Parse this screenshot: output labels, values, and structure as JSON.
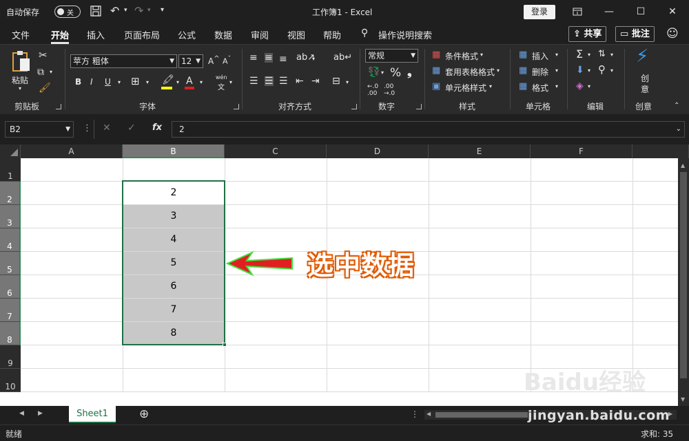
{
  "titlebar": {
    "autosave_label": "自动保存",
    "autosave_state": "关",
    "doc_title": "工作簿1  -  Excel",
    "login_label": "登录"
  },
  "tabs": [
    "文件",
    "开始",
    "插入",
    "页面布局",
    "公式",
    "数据",
    "审阅",
    "视图",
    "帮助"
  ],
  "active_tab": "开始",
  "search_label": "操作说明搜索",
  "share_label": "共享",
  "comment_label": "批注",
  "ribbon": {
    "paste_label": "粘贴",
    "clipboard_label": "剪贴板",
    "font_name": "苹方 粗体",
    "font_size": "12",
    "font_label": "字体",
    "align_label": "对齐方式",
    "number_format": "常规",
    "number_label": "数字",
    "cond_format": "条件格式",
    "table_format": "套用表格格式",
    "cell_style": "单元格样式",
    "style_label": "样式",
    "insert_label": "插入",
    "delete_label": "删除",
    "format_label": "格式",
    "cells_label": "单元格",
    "edit_label": "编辑",
    "create_label1": "创",
    "create_label2": "意",
    "create_group": "创意",
    "bold": "B",
    "italic": "I",
    "underline": "U",
    "phonetic": "wén",
    "phonetic2": "文"
  },
  "formula": {
    "namebox": "B2",
    "fx": "fx",
    "value": "2"
  },
  "columns": [
    "A",
    "B",
    "C",
    "D",
    "E",
    "F"
  ],
  "rows": [
    "1",
    "2",
    "3",
    "4",
    "5",
    "6",
    "7",
    "8",
    "9",
    "10"
  ],
  "cells_b": [
    "2",
    "3",
    "4",
    "5",
    "6",
    "7",
    "8"
  ],
  "callout_text": "选中数据",
  "sheet_name": "Sheet1",
  "status": {
    "ready": "就绪",
    "sum": "求和: 35"
  },
  "watermark": {
    "brand": "Baidu经验",
    "url": "jingyan.baidu.com"
  },
  "colors": {
    "accent_green": "#1e7145",
    "selection_border": "#2e8b57",
    "arrow_red": "#e02020"
  }
}
